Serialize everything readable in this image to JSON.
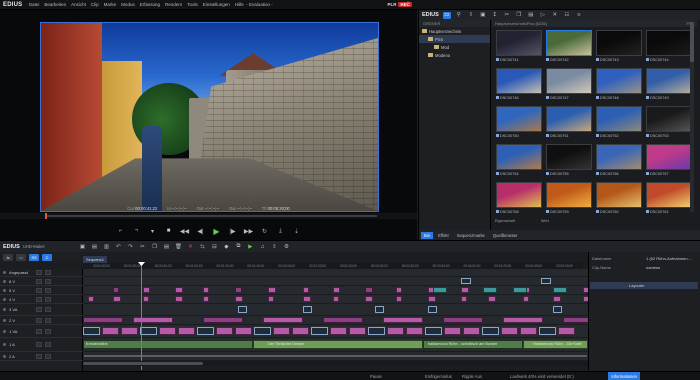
{
  "app": {
    "brand": "EDIUS",
    "title_tail": "- Evaluation -"
  },
  "menu": [
    "Datei",
    "Bearbeiten",
    "Ansicht",
    "Clip",
    "Marke",
    "Modus",
    "Erfassung",
    "Rendern",
    "Tools",
    "Einstellungen",
    "Hilfe"
  ],
  "player": {
    "badge_plr": "PLR",
    "badge_rec": "REC",
    "timecodes": [
      {
        "label": "Cur",
        "value": "00:00:41;22"
      },
      {
        "label": "In",
        "value": "--:--:--;--"
      },
      {
        "label": "Out",
        "value": "--:--:--;--"
      },
      {
        "label": "Dur",
        "value": "--:--:--;--"
      },
      {
        "label": "Ttl",
        "value": "00:05:20;00"
      }
    ]
  },
  "bin": {
    "brand": "EDIUS",
    "folder_header": "ORDNER",
    "folders": [
      {
        "label": "Hauptverzeichnis",
        "level": 0,
        "selected": false
      },
      {
        "label": "Pics",
        "level": 1,
        "selected": true
      },
      {
        "label": "Mod",
        "level": 2,
        "selected": false
      },
      {
        "label": "Modeno",
        "level": 1,
        "selected": false
      }
    ],
    "path": "Hauptverzeichnis\\Pics (6235)",
    "count": "FNL",
    "thumbnails": [
      {
        "label": "DSC00741",
        "colors": [
          "#223",
          "#556"
        ]
      },
      {
        "label": "DSC00742",
        "colors": [
          "#4a6a3a",
          "#c8c0a0"
        ]
      },
      {
        "label": "DSC00743",
        "colors": [
          "#0a0a0a",
          "#222"
        ]
      },
      {
        "label": "DSC00744",
        "colors": [
          "#0a0a0a",
          "#1b1b1b"
        ]
      },
      {
        "label": "DSC00746",
        "colors": [
          "#2a58b8",
          "#c6c0b0"
        ]
      },
      {
        "label": "DSC00747",
        "colors": [
          "#7a8aa0",
          "#d0c8b8"
        ]
      },
      {
        "label": "DSC00748",
        "colors": [
          "#2f5fbf",
          "#9a9486"
        ]
      },
      {
        "label": "DSC00749",
        "colors": [
          "#315ea8",
          "#b7ae9a"
        ]
      },
      {
        "label": "DSC00750",
        "colors": [
          "#2e66c0",
          "#a7794a"
        ]
      },
      {
        "label": "DSC00751",
        "colors": [
          "#2a5fb0",
          "#c8a87c"
        ]
      },
      {
        "label": "DSC00752",
        "colors": [
          "#2c5fb4",
          "#8c8a7a"
        ]
      },
      {
        "label": "DSC00753",
        "colors": [
          "#1a1a1a",
          "#555"
        ]
      },
      {
        "label": "DSC00754",
        "colors": [
          "#2d60b5",
          "#b07b4c"
        ]
      },
      {
        "label": "DSC00755",
        "colors": [
          "#0f0f0f",
          "#333"
        ]
      },
      {
        "label": "DSC00756",
        "colors": [
          "#3a66b8",
          "#a08c70"
        ]
      },
      {
        "label": "DSC00757",
        "colors": [
          "#c03a8a",
          "#6a3aa8"
        ]
      },
      {
        "label": "DSC00758",
        "colors": [
          "#b82e6a",
          "#e0c050"
        ]
      },
      {
        "label": "DSC00759",
        "colors": [
          "#c05a1a",
          "#f0b040"
        ]
      },
      {
        "label": "DSC00760",
        "colors": [
          "#b4581a",
          "#e4c070"
        ]
      },
      {
        "label": "DSC00761",
        "colors": [
          "#c04a2a",
          "#f0d070"
        ]
      }
    ],
    "props": [
      "Eigenschaft",
      "Wert"
    ],
    "tabs": [
      {
        "label": "Bin",
        "active": true
      },
      {
        "label": "Effekt",
        "active": false
      },
      {
        "label": "Sequenzmarke",
        "active": false
      },
      {
        "label": "Quellbrowser",
        "active": false
      }
    ]
  },
  "timeline": {
    "brand": "EDIUS",
    "title": "UHD-Maker",
    "tools": [
      "SS",
      "C"
    ],
    "sequence_tab": "Sequenz1",
    "ruler_marks": [
      "00:00:00;00",
      "00:00:20;00",
      "00:00:40;00",
      "00:01:00;00",
      "00:01:20;00",
      "00:01:40;00",
      "00:02:00;00",
      "00:02:20;00",
      "00:02:40;00",
      "00:03:00;00",
      "00:03:20;00",
      "00:03:40;00",
      "00:04:00;00",
      "00:04:20;00",
      "00:04:40;00",
      "00:05:00;00"
    ],
    "tracks": [
      {
        "label": "Angepasst"
      },
      {
        "label": "6 V"
      },
      {
        "label": "5 V"
      },
      {
        "label": "4 V"
      },
      {
        "label": "3 VA"
      },
      {
        "label": "2 V"
      },
      {
        "label": "1 VA"
      },
      {
        "label": "1 A"
      },
      {
        "label": "2 A"
      }
    ],
    "audio_labels": [
      "Kreidewölkel",
      "Der Trinkliche Denker",
      "halbamrock Rühn - schottisch am Bunker",
      "Halbamrock Rühn - Die Kraft"
    ]
  },
  "right_panel": {
    "rows": [
      {
        "label": "Dateiname",
        "value": "1 (62 Rühn-Aufnahmen-..."
      },
      {
        "label": "Clip-Name",
        "value": "nameso"
      }
    ],
    "selected": "Layouter"
  },
  "status": {
    "items": [
      "Pause",
      "Einfügemodus",
      "Ripple Aus",
      "Laufwerk 40% wird verwendet (E:)"
    ],
    "info": "Informationen"
  }
}
